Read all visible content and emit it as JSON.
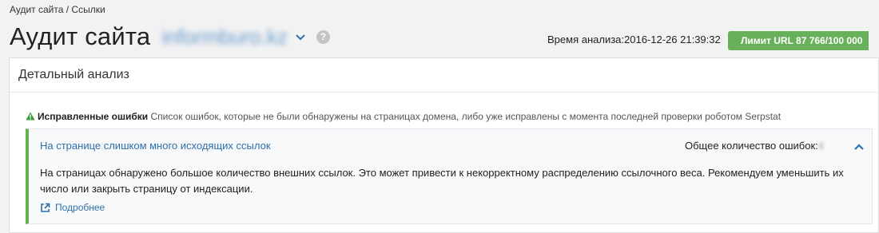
{
  "breadcrumb": "Аудит сайта / Ссылки",
  "header": {
    "title": "Аудит сайта",
    "domain": "informburo.kz",
    "help_icon": "question-mark-icon",
    "dropdown_icon": "chevron-down-icon"
  },
  "analysis_time": "Время анализа:2016-12-26 21:39:32",
  "limit_button": "Лимит URL 87 766/100 000",
  "panel": {
    "title": "Детальный анализ",
    "section": {
      "icon": "warning-triangle-icon",
      "title": "Исправленные ошибки",
      "description": "Список ошибок, которые не были обнаружены на страницах домена, либо уже исправлены с момента последней проверки роботом Serpstat"
    },
    "error": {
      "title": "На странице слишком много исходящих ссылок",
      "count_label": "Общее количество ошибок:",
      "count_value": "4",
      "collapse_icon": "chevron-up-icon",
      "description": "На страницах обнаружено большое количество внешних ссылок. Это может привести к некорректному распределению ссылочного веса. Рекомендуем уменьшить их число или закрыть страницу от индексации.",
      "more_label": "Подробнее",
      "more_icon": "external-link-icon"
    }
  },
  "colors": {
    "accent_green": "#69b05a",
    "link_blue": "#2f6fa9",
    "warning_green": "#3b9a3b"
  }
}
